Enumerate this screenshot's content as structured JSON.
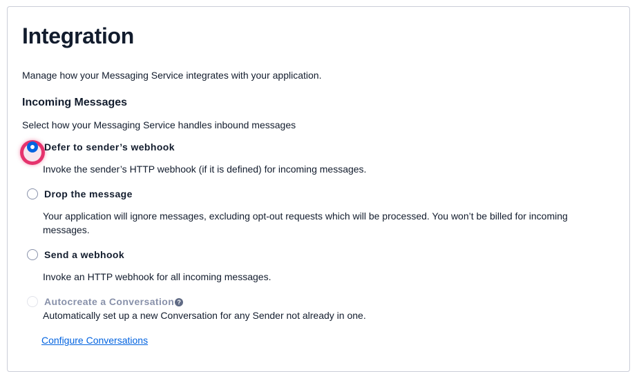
{
  "page": {
    "title": "Integration",
    "description": "Manage how your Messaging Service integrates with your application."
  },
  "incoming": {
    "heading": "Incoming Messages",
    "help": "Select how your Messaging Service handles inbound messages",
    "selected": "defer",
    "options": [
      {
        "id": "defer",
        "label": "Defer to sender’s webhook",
        "help": "Invoke the sender’s HTTP webhook (if it is defined) for incoming messages.",
        "checked": true,
        "disabled": false
      },
      {
        "id": "drop",
        "label": "Drop the message",
        "help": "Your application will ignore messages, excluding opt-out requests which will be processed. You won’t be billed for incoming messages.",
        "checked": false,
        "disabled": false
      },
      {
        "id": "webhook",
        "label": "Send a webhook",
        "help": "Invoke an HTTP webhook for all incoming messages.",
        "checked": false,
        "disabled": false
      },
      {
        "id": "autocreate",
        "label": "Autocreate a Conversation",
        "help": "Automatically set up a new Conversation for any Sender not already in one.",
        "checked": false,
        "disabled": true,
        "help_icon": "question-circle-icon",
        "help_icon_glyph": "?"
      }
    ],
    "link": "Configure Conversations"
  },
  "colors": {
    "primary": "#0263e0",
    "focus_highlight": "#e5336d",
    "text": "#121c2d",
    "disabled_text": "#8891aa"
  }
}
